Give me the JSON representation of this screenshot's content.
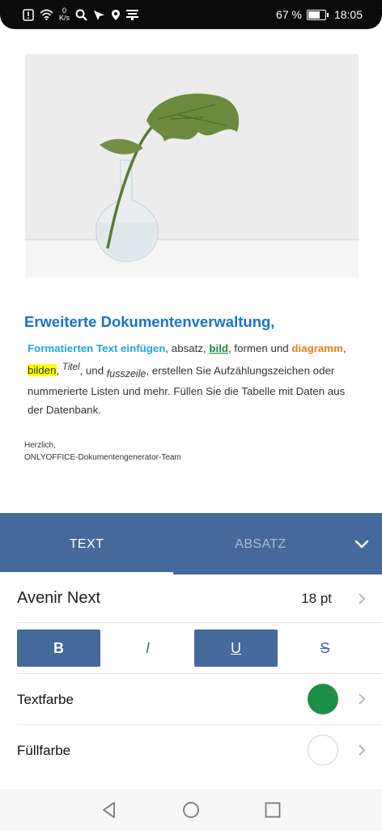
{
  "status_bar": {
    "speed_value": "0",
    "speed_unit": "K/s",
    "battery": "67 %",
    "time": "18:05",
    "icons": [
      "notification-icon",
      "wifi-icon",
      "search-icon",
      "navigation-icon",
      "location-icon",
      "menu-icon",
      "battery-icon"
    ]
  },
  "document": {
    "heading": "Erweiterte Dokumentenverwaltung,",
    "body": {
      "formatted_text": "Formatierten Text einfügen",
      "t1": ",  absatz, ",
      "bild": "bild",
      "t2": ", formen und ",
      "diagramm": "diagramm",
      "t3": ",",
      "bilden": "bilden",
      "t4": ", ",
      "titel": "Titel",
      "t5": ", und ",
      "fusszeile": "fusszeile",
      "t6": ", erstellen Sie Aufzählungszeichen oder nummerierte Listen und mehr. Füllen Sie die Tabelle mit Daten aus der Datenbank."
    },
    "signature_line1": "Herzlich,",
    "signature_line2": "ONLYOFFICE-Dokumentengenerator-Team"
  },
  "tabs": {
    "text": "TEXT",
    "absatz": "ABSATZ",
    "active": "TEXT"
  },
  "panel": {
    "font_name": "Avenir Next",
    "font_size": "18 pt",
    "bold": "B",
    "italic": "I",
    "underline": "U",
    "strikethrough": "S",
    "bold_active": true,
    "italic_active": false,
    "underline_active": true,
    "strikethrough_active": false,
    "text_color_label": "Textfarbe",
    "text_color": "#1e8e46",
    "fill_color_label": "Füllfarbe",
    "fill_color": "#ffffff"
  },
  "colors": {
    "accent": "#44699a",
    "heading_blue": "#1a73c8"
  }
}
